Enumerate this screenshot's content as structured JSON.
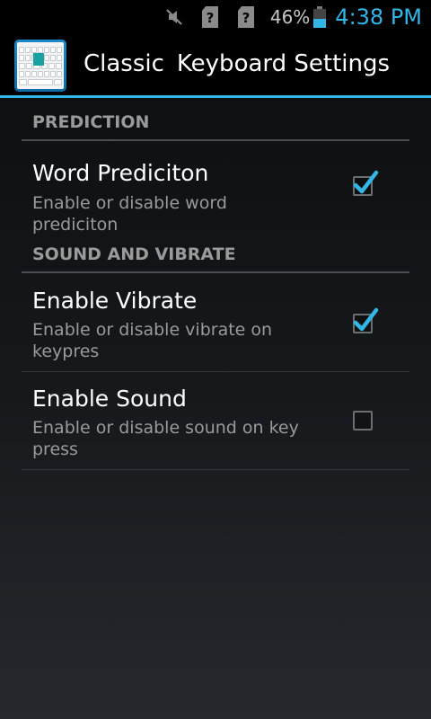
{
  "status_bar": {
    "icons": [
      "mute-icon",
      "sim-unknown-icon",
      "sim-unknown-icon"
    ],
    "battery_percent": "46%",
    "battery_level": 0.46,
    "time": "4:38 PM",
    "accent_color": "#33b5e5"
  },
  "action_bar": {
    "app_icon": "keyboard-app-icon",
    "title_part1": "Classic",
    "title_part2": "Keyboard Settings"
  },
  "sections": [
    {
      "header": "PREDICTION",
      "items": [
        {
          "title": "Word Prediciton",
          "summary": "Enable or disable word prediciton",
          "checked": true
        }
      ]
    },
    {
      "header": "SOUND AND VIBRATE",
      "items": [
        {
          "title": "Enable Vibrate",
          "summary": "Enable or disable vibrate on keypres",
          "checked": true
        },
        {
          "title": "Enable Sound",
          "summary": "Enable or disable sound on key press",
          "checked": false
        }
      ]
    }
  ]
}
